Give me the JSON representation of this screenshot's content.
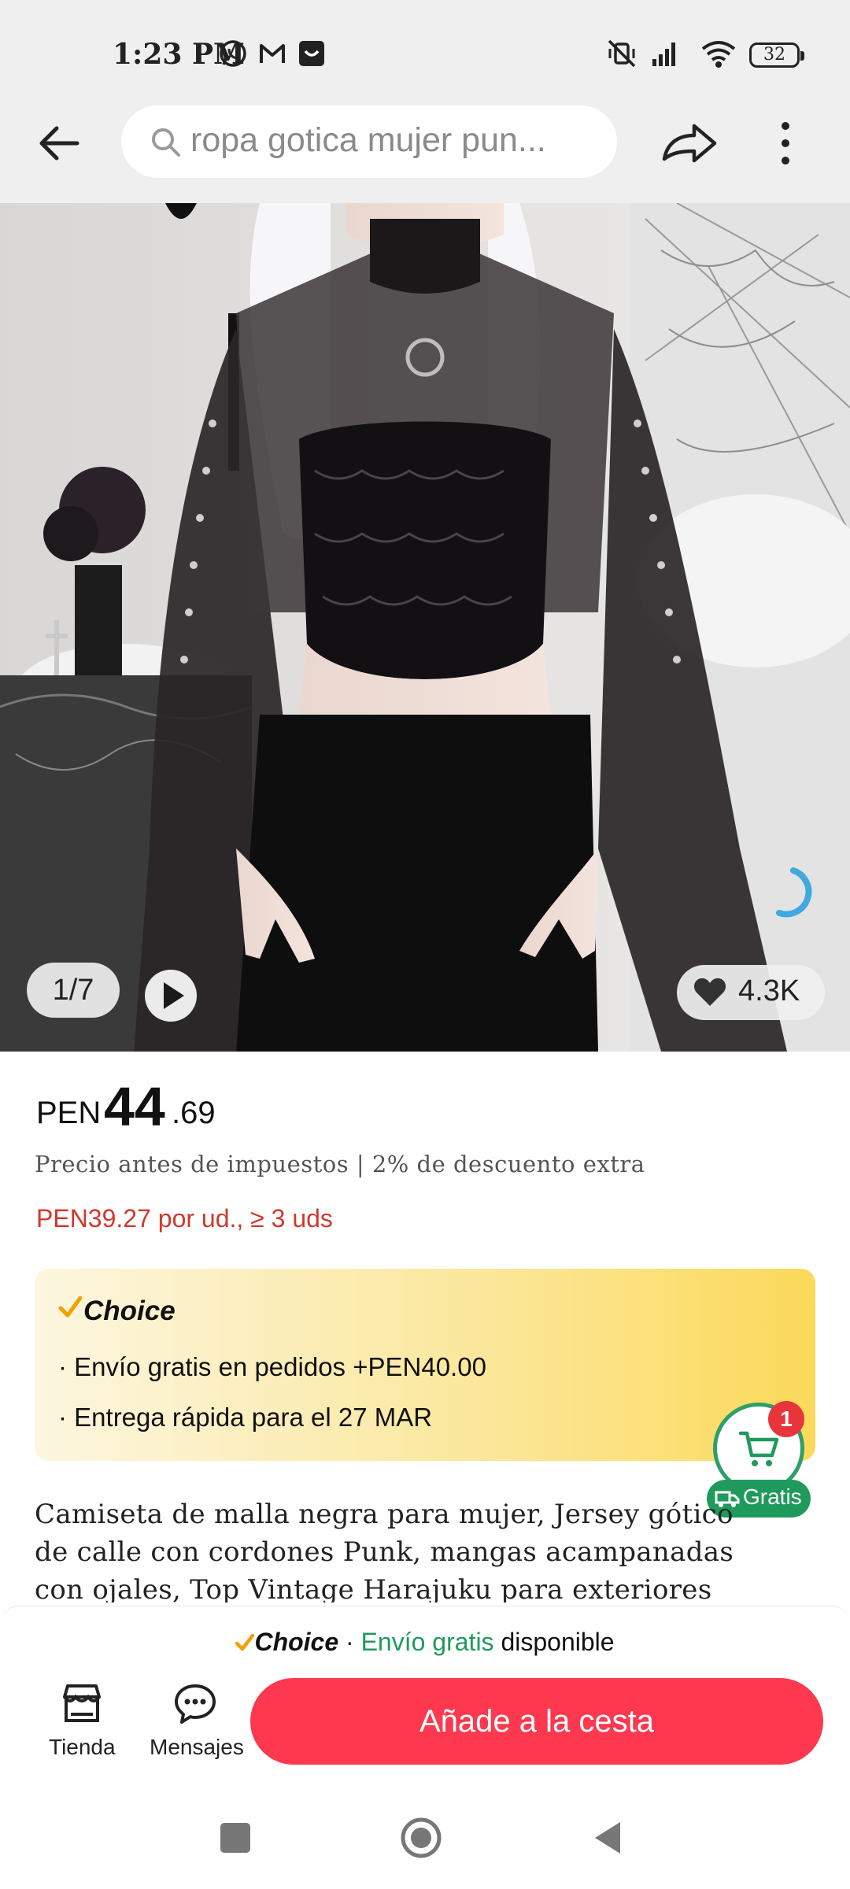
{
  "status_bar": {
    "time": "1:23 PM",
    "battery": "32"
  },
  "header": {
    "search_text": "ropa gotica mujer pun..."
  },
  "gallery": {
    "counter": "1/7",
    "wishlist_count": "4.3K"
  },
  "price": {
    "currency": "PEN",
    "main": "44",
    "decimals": ".69",
    "tax_note": "Precio antes de impuestos | 2% de descuento extra",
    "bulk": "PEN39.27 por ud., ≥ 3 uds"
  },
  "choice": {
    "label": "Choice",
    "line1": "· Envío gratis en pedidos +PEN40.00",
    "line2": "· Entrega rápida para el 27 MAR"
  },
  "cart_float": {
    "badge": "1",
    "gratis": "Gratis"
  },
  "description": "Camiseta de malla negra para mujer, Jersey gótico de calle con cordones Punk, mangas acampanadas con ojales, Top Vintage Harajuku para exteriores",
  "bottom_bar": {
    "strip_choice": "Choice",
    "strip_sep": " · ",
    "strip_free": "Envío gratis",
    "strip_available": " disponible",
    "store_label": "Tienda",
    "messages_label": "Mensajes",
    "add_to_cart": "Añade a la cesta"
  },
  "colors": {
    "accent_red": "#fd384f",
    "price_red": "#d1382c",
    "green": "#1f9a5c",
    "choice_gold": "#fcd95a"
  }
}
